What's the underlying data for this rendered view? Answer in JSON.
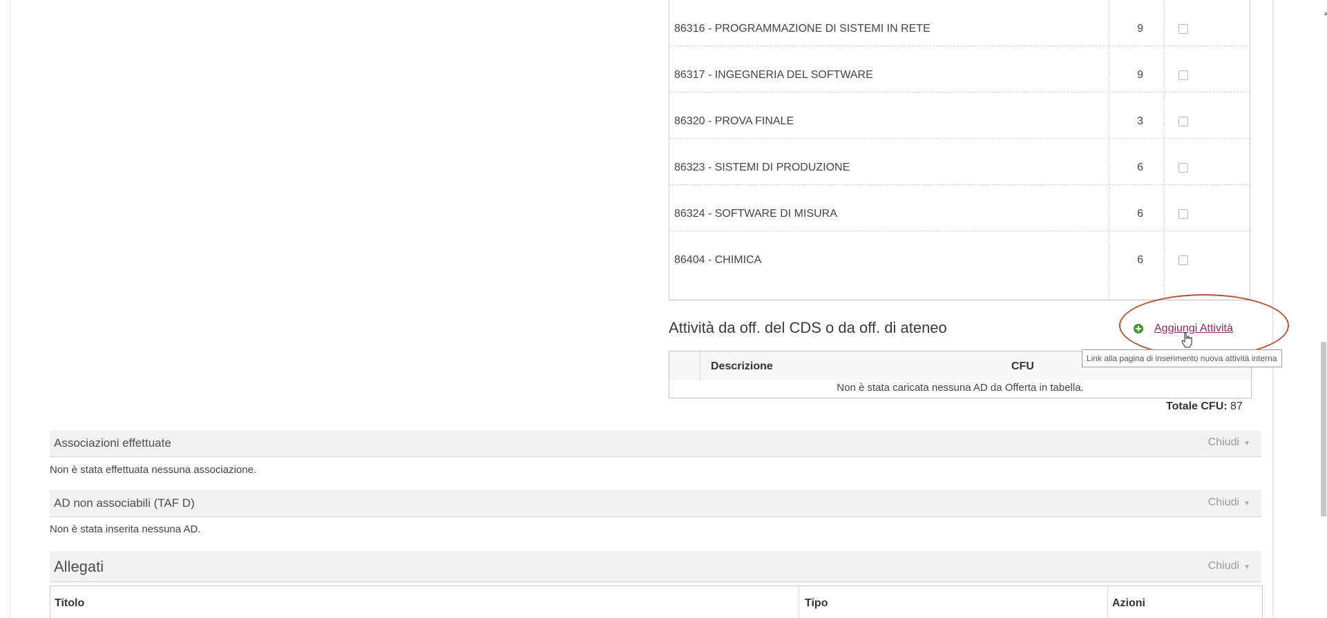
{
  "activities": {
    "rows": [
      {
        "name": "86316 - PROGRAMMAZIONE DI SISTEMI IN RETE",
        "cfu": "9"
      },
      {
        "name": "86317 - INGEGNERIA DEL SOFTWARE",
        "cfu": "9"
      },
      {
        "name": "86320 - PROVA FINALE",
        "cfu": "3"
      },
      {
        "name": "86323 - SISTEMI DI PRODUZIONE",
        "cfu": "6"
      },
      {
        "name": "86324 - SOFTWARE DI MISURA",
        "cfu": "6"
      },
      {
        "name": "86404 - CHIMICA",
        "cfu": "6"
      }
    ]
  },
  "offerta": {
    "heading": "Attività da off. del CDS o da off. di ateneo",
    "add_link": "Aggiungi Attività",
    "tooltip": "Link alla pagina di inserimento nuova attività interna",
    "col_descrizione": "Descrizione",
    "col_cfu": "CFU",
    "empty_message": "Non è stata caricata nessuna AD da Offerta in tabella.",
    "totale_label": "Totale CFU:",
    "totale_value": "87",
    "plus_icon": "plus-circle-icon",
    "accent_color": "#8e2563"
  },
  "associazioni": {
    "title": "Associazioni effettuate",
    "toggle": "Chiudi",
    "message": "Non è stata effettuata nessuna associazione."
  },
  "ad_non_associabili": {
    "title": "AD non associabili (TAF D)",
    "toggle": "Chiudi",
    "message": "Non è stata inserita nessuna AD."
  },
  "allegati": {
    "title": "Allegati",
    "toggle": "Chiudi",
    "col_titolo": "Titolo",
    "col_tipo": "Tipo",
    "col_azioni": "Azioni"
  }
}
